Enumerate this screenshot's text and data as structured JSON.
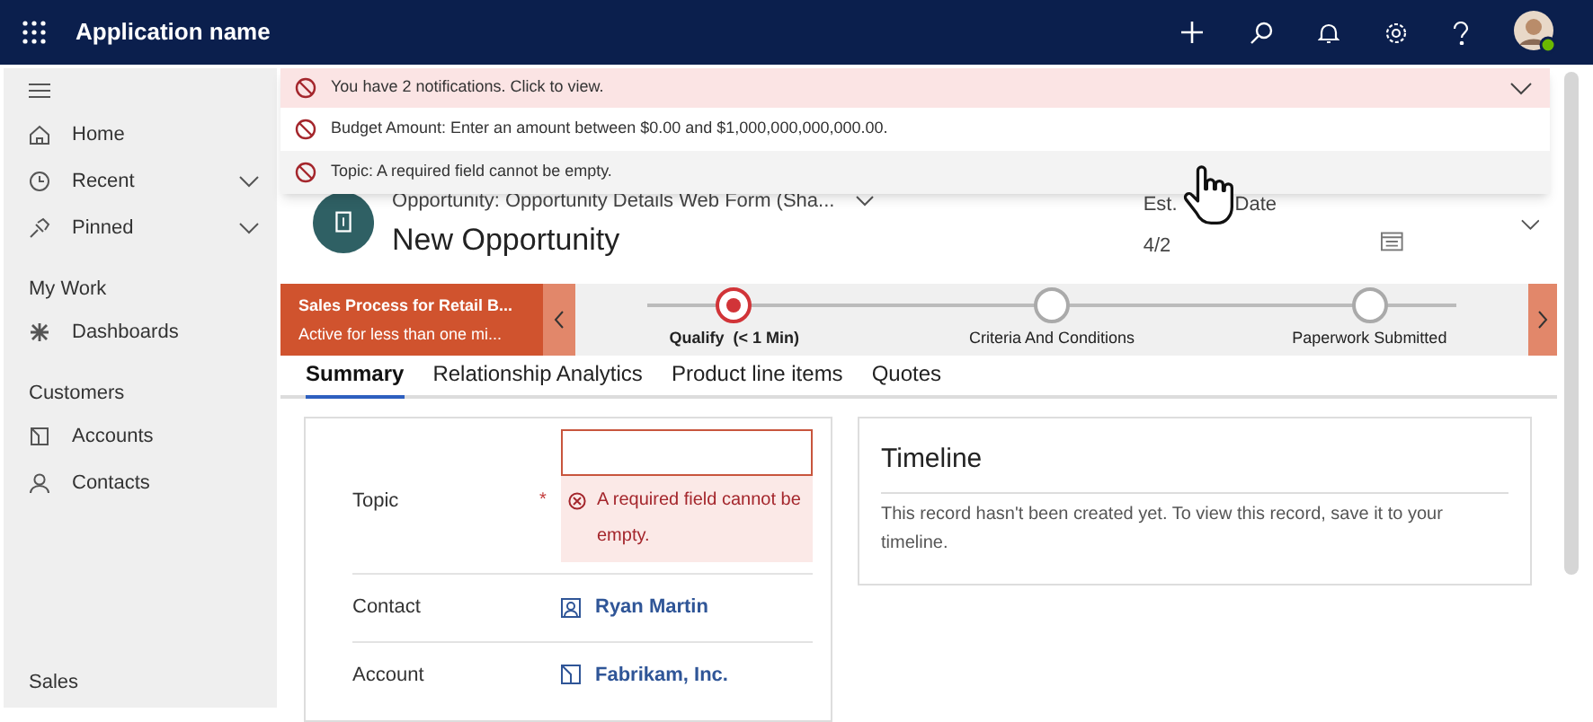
{
  "app": {
    "title": "Application name"
  },
  "sidebar": {
    "items": [
      {
        "kind": "item",
        "label": "Home"
      },
      {
        "kind": "item",
        "label": "Recent",
        "expanded": false
      },
      {
        "kind": "item",
        "label": "Pinned",
        "expanded": false
      },
      {
        "kind": "heading",
        "label": "My Work"
      },
      {
        "kind": "item",
        "label": "Dashboards"
      },
      {
        "kind": "heading",
        "label": "Customers"
      },
      {
        "kind": "item",
        "label": "Accounts"
      },
      {
        "kind": "item",
        "label": "Contacts"
      },
      {
        "kind": "footer",
        "label": "Sales"
      }
    ]
  },
  "notifications": {
    "summary": "You have 2 notifications. Click to view.",
    "expanded": true,
    "items": [
      "Budget Amount: Enter an amount between $0.00 and $1,000,000,000,000.00.",
      "Topic: A required field cannot be empty."
    ]
  },
  "record": {
    "entity": "Opportunity: Opportunity Details Web Form (Sha...",
    "title": "New Opportunity",
    "header_label_start": "Est.",
    "header_label_end": "Date",
    "header_value": "4/2"
  },
  "process": {
    "name": "Sales Process for Retail B...",
    "status": "Active for less than one mi...",
    "stages": [
      {
        "label": "Qualify",
        "duration": "(< 1 Min)",
        "selected": true
      },
      {
        "label": "Criteria And Conditions",
        "selected": false
      },
      {
        "label": "Paperwork Submitted",
        "selected": false
      }
    ]
  },
  "tabs": [
    {
      "label": "Summary",
      "selected": true
    },
    {
      "label": "Relationship Analytics",
      "selected": false
    },
    {
      "label": "Product line items",
      "selected": false
    },
    {
      "label": "Quotes",
      "selected": false
    }
  ],
  "form": {
    "fields": [
      {
        "kind": "text",
        "label": "Topic",
        "required_marker": "*",
        "error": "A required field cannot be empty."
      },
      {
        "kind": "lookup",
        "label": "Contact",
        "value": "Ryan Martin"
      },
      {
        "kind": "lookup",
        "label": "Account",
        "value": "Fabrikam, Inc."
      }
    ]
  },
  "timeline": {
    "title": "Timeline",
    "message": "This record hasn't been created yet.  To view this record, save it to your timeline."
  }
}
